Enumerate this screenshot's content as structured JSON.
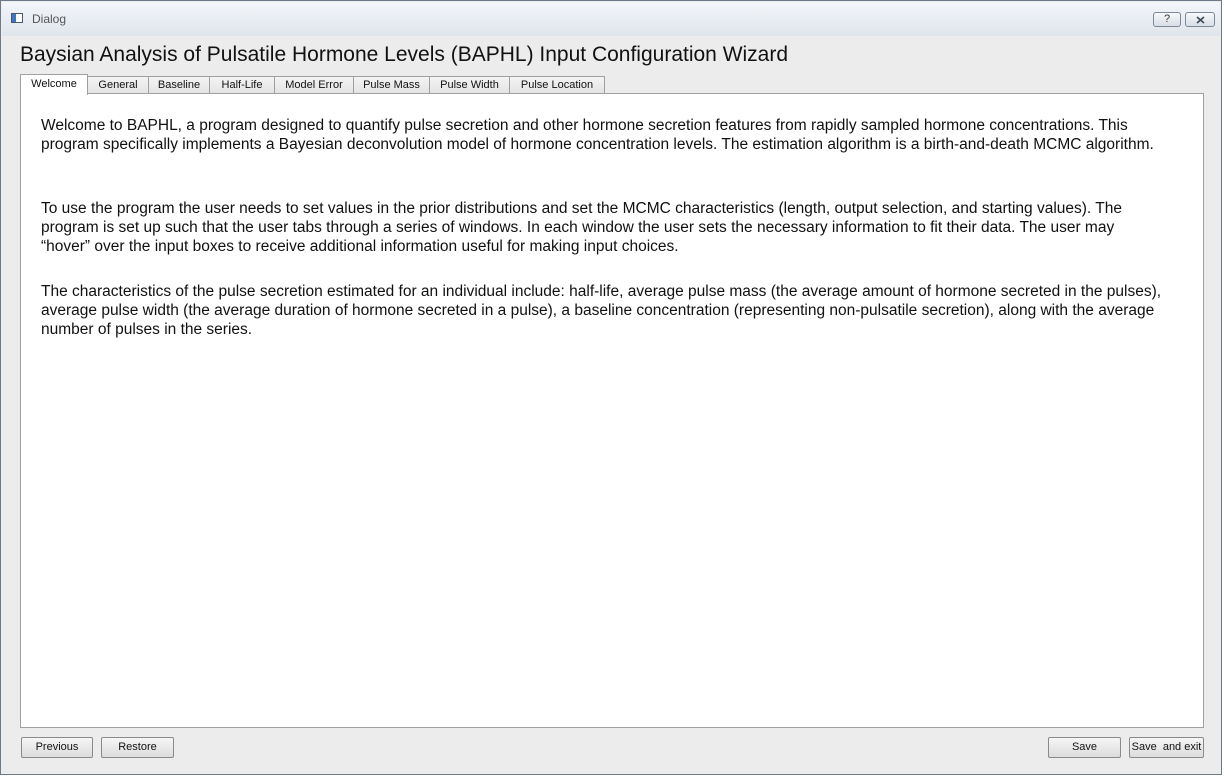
{
  "window": {
    "title": "Dialog",
    "help_label": "?"
  },
  "heading": "Baysian Analysis of Pulsatile Hormone Levels (BAPHL) Input Configuration Wizard",
  "tabs": [
    {
      "label": "Welcome",
      "active": true
    },
    {
      "label": "General",
      "active": false
    },
    {
      "label": "Baseline",
      "active": false
    },
    {
      "label": "Half-Life",
      "active": false
    },
    {
      "label": "Model Error",
      "active": false
    },
    {
      "label": "Pulse Mass",
      "active": false
    },
    {
      "label": "Pulse Width",
      "active": false
    },
    {
      "label": "Pulse Location",
      "active": false
    }
  ],
  "welcome": {
    "paragraphs": [
      "Welcome to BAPHL, a program designed to quantify pulse secretion and other hormone secretion features from rapidly sampled hormone concentrations.  This program specifically implements a Bayesian deconvolution model of hormone concentration levels.  The estimation algorithm is a birth-and-death MCMC algorithm.",
      "To use the program the user needs to set values in the prior distributions and set the MCMC  characteristics (length, output selection, and starting values).  The program is set up such that the user tabs through a series of windows.  In each window the user sets the necessary information to fit their data.  The user may “hover” over the input boxes to receive additional information useful for making input choices.",
      "The characteristics of the pulse secretion estimated for an individual include: half-life, average pulse mass (the average amount of hormone secreted in the pulses), average pulse width (the average duration of hormone secreted in a pulse), a baseline concentration (representing non-pulsatile secretion), along with the average number of pulses in the series."
    ]
  },
  "buttons": {
    "previous": "Previous",
    "restore": "Restore",
    "save": "Save",
    "save_exit": "Save  and exit"
  }
}
